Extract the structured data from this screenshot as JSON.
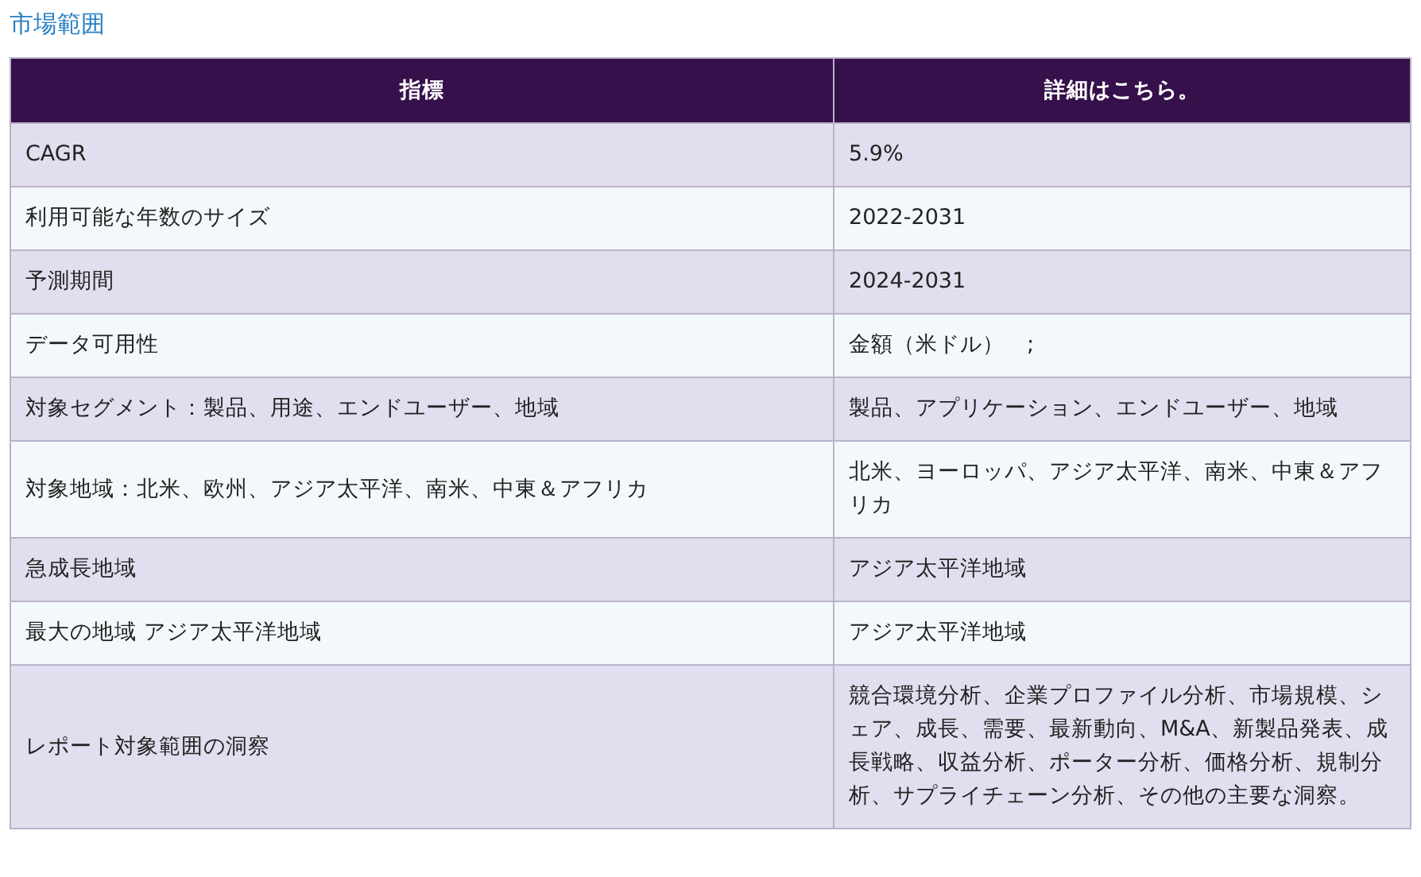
{
  "title": "市場範囲",
  "table": {
    "columns": [
      "指標",
      "詳細はこちら。"
    ],
    "rows": [
      [
        "CAGR",
        "5.9%"
      ],
      [
        "利用可能な年数のサイズ",
        "2022-2031"
      ],
      [
        "予測期間",
        "2024-2031"
      ],
      [
        "データ可用性",
        "金額（米ドル）　;"
      ],
      [
        "対象セグメント：製品、用途、エンドユーザー、地域",
        "製品、アプリケーション、エンドユーザー、地域"
      ],
      [
        "対象地域：北米、欧州、アジア太平洋、南米、中東＆アフリカ",
        "北米、ヨーロッパ、アジア太平洋、南米、中東＆アフリカ"
      ],
      [
        "急成長地域",
        "アジア太平洋地域"
      ],
      [
        "最大の地域 アジア太平洋地域",
        "アジア太平洋地域"
      ],
      [
        "レポート対象範囲の洞察",
        "競合環境分析、企業プロファイル分析、市場規模、シェア、成長、需要、最新動向、M&A、新製品発表、成長戦略、収益分析、ポーター分析、価格分析、規制分析、サプライチェーン分析、その他の主要な洞察。"
      ]
    ]
  }
}
